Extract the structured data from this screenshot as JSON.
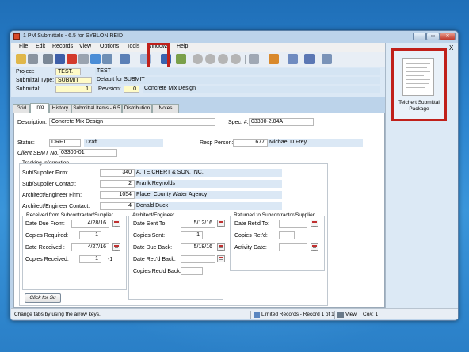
{
  "window": {
    "title": "1 PM Submittals - 6.5 for SYBLON REID",
    "controls": {
      "minimize": "–",
      "maximize": "▭",
      "close": "✕"
    }
  },
  "menu": [
    "File",
    "Edit",
    "Records",
    "View",
    "Options",
    "Tools",
    "Windows",
    "Help"
  ],
  "toolbar_icons": [
    "open-folder-icon",
    "binoculars-icon",
    "print-icon",
    "save-icon",
    "delete-icon",
    "undo-icon",
    "refresh-icon",
    "search-icon",
    "document-icon",
    "attachment-icon",
    "route-icon",
    "checkmark-icon",
    "first-record-icon",
    "prev-record-icon",
    "next-record-icon",
    "last-record-icon",
    "link-icon",
    "users-icon",
    "edit-pencil-icon",
    "spell-check-icon",
    "tools-icon"
  ],
  "header": {
    "project_label": "Project:",
    "project_value": "TEST.",
    "project_desc": "TEST",
    "type_label": "Submittal Type:",
    "type_value": "SUBMIT",
    "type_desc": "Default for SUBMIT",
    "submittal_label": "Submittal:",
    "submittal_value": "1",
    "revision_label": "Revision:",
    "revision_value": "0",
    "submittal_desc": "Concrete Mix Design"
  },
  "tabs": [
    "Grid",
    "Info",
    "History",
    "Submittal Items - 6.5",
    "Distribution",
    "Notes"
  ],
  "active_tab": "Info",
  "info": {
    "description_label": "Description:",
    "description_value": "Concrete Mix Design",
    "spec_label": "Spec. #:",
    "spec_value": "03300-2.04A",
    "status_label": "Status:",
    "status_value": "DRFT",
    "status_desc": "Draft",
    "resp_label": "Resp Person:",
    "resp_id": "677",
    "resp_name": "Michael D Frey",
    "client_label": "Client SBMT No.:",
    "client_value": "03300-01"
  },
  "tracking": {
    "title": "Tracking Information",
    "rows": [
      {
        "label": "Sub/Supplier Firm:",
        "id": "340",
        "name": "A. TEICHERT & SON, INC."
      },
      {
        "label": "Sub/Supplier Contact:",
        "id": "2",
        "name": "Frank    Reynolds"
      },
      {
        "label": "Architect/Engineer Firm:",
        "id": "1054",
        "name": "Placer County Water Agency"
      },
      {
        "label": "Architect/Engineer Contact:",
        "id": "4",
        "name": "Donald    Duck"
      }
    ]
  },
  "received_group": {
    "title": "Received from Subcontractor/Supplier",
    "date_due_label": "Date Due From:",
    "date_due_value": "4/28/16",
    "copies_req_label": "Copies Required:",
    "copies_req_value": "1",
    "date_received_label": "Date Received :",
    "date_received_value": "4/27/16",
    "copies_received_label": "Copies Received:",
    "copies_received_value": "1",
    "copies_received_diff": "-1"
  },
  "architect_group": {
    "title": "Architect/Engineer",
    "date_sent_label": "Date Sent To:",
    "date_sent_value": "5/12/16",
    "copies_sent_label": "Copies Sent:",
    "copies_sent_value": "1",
    "date_due_back_label": "Date Due Back:",
    "date_due_back_value": "5/18/16",
    "date_recd_back_label": "Date Rec'd Back:",
    "date_recd_back_value": "",
    "copies_recd_back_label": "Copies Rec'd Back:",
    "copies_recd_back_value": ""
  },
  "returned_group": {
    "title": "Returned to Subcontractor/Supplier",
    "date_retd_label": "Date Ret'd To:",
    "date_retd_value": "",
    "copies_retd_label": "Copies Ret'd:",
    "copies_retd_value": "",
    "activity_label": "Activity Date:",
    "activity_value": ""
  },
  "click_button": "Click for Su",
  "status": {
    "hint": "Change tabs by using the arrow keys.",
    "records": "Limited Records - Record 1 of 1",
    "view": "View",
    "co": "Co#: 1"
  },
  "side_panel": {
    "close": "X",
    "doc_label": "Teichert Submittal Package"
  }
}
